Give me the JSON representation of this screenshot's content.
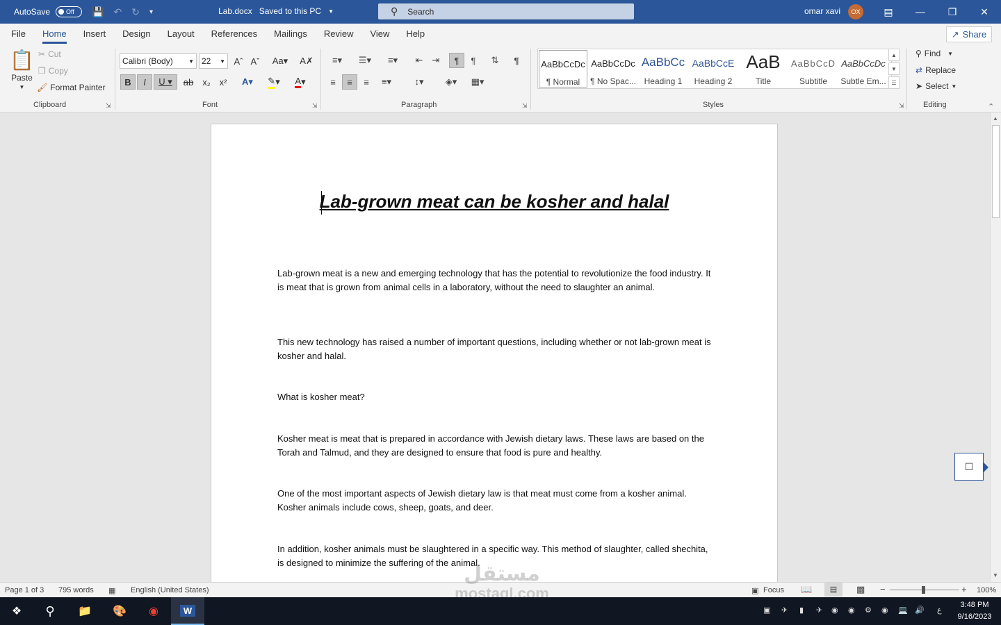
{
  "titlebar": {
    "autosave_label": "AutoSave",
    "autosave_state": "Off",
    "doc_name": "Lab.docx",
    "save_status": "Saved to this PC",
    "search_placeholder": "Search",
    "user_name": "omar xavi",
    "user_initials": "OX"
  },
  "tabs": [
    "File",
    "Home",
    "Insert",
    "Design",
    "Layout",
    "References",
    "Mailings",
    "Review",
    "View",
    "Help"
  ],
  "active_tab": "Home",
  "share_label": "Share",
  "clipboard": {
    "paste": "Paste",
    "cut": "Cut",
    "copy": "Copy",
    "format_painter": "Format Painter",
    "group": "Clipboard"
  },
  "font": {
    "family": "Calibri (Body)",
    "size": "22",
    "group": "Font"
  },
  "paragraph": {
    "group": "Paragraph"
  },
  "styles": {
    "group": "Styles",
    "items": [
      {
        "preview": "AaBbCcDc",
        "name": "¶ Normal"
      },
      {
        "preview": "AaBbCcDc",
        "name": "¶ No Spac..."
      },
      {
        "preview": "AaBbCc",
        "name": "Heading 1"
      },
      {
        "preview": "AaBbCcE",
        "name": "Heading 2"
      },
      {
        "preview": "AaB",
        "name": "Title"
      },
      {
        "preview": "AaBbCcD",
        "name": "Subtitle"
      },
      {
        "preview": "AaBbCcDc",
        "name": "Subtle Em..."
      }
    ]
  },
  "editing": {
    "find": "Find",
    "replace": "Replace",
    "select": "Select",
    "group": "Editing"
  },
  "document": {
    "title": "Lab-grown meat can be kosher and halal",
    "paragraphs": [
      "Lab-grown meat is a new and emerging technology that has the potential to revolutionize the food industry. It is meat that is grown from animal cells in a laboratory, without the need to slaughter an animal.",
      "This new technology has raised a number of important questions, including whether or not lab-grown meat is kosher and halal.",
      "What is kosher meat?",
      "Kosher meat is meat that is prepared in accordance with Jewish dietary laws. These laws are based on the Torah and Talmud, and they are designed to ensure that food is pure and healthy.",
      "One of the most important aspects of Jewish dietary law is that meat must come from a kosher animal. Kosher animals include cows, sheep, goats, and deer.",
      "In addition, kosher animals must be slaughtered in a specific way. This method of slaughter, called shechita, is designed to minimize the suffering of the animal."
    ]
  },
  "status": {
    "page": "Page 1 of 3",
    "words": "795 words",
    "language": "English (United States)",
    "focus": "Focus",
    "zoom": "100%",
    "zoom_minus": "−",
    "zoom_plus": "+"
  },
  "watermark": {
    "arabic": "مستقل",
    "latin": "mostaql.com"
  },
  "taskbar": {
    "time": "3:48 PM",
    "date": "9/16/2023",
    "lang": "ع"
  }
}
